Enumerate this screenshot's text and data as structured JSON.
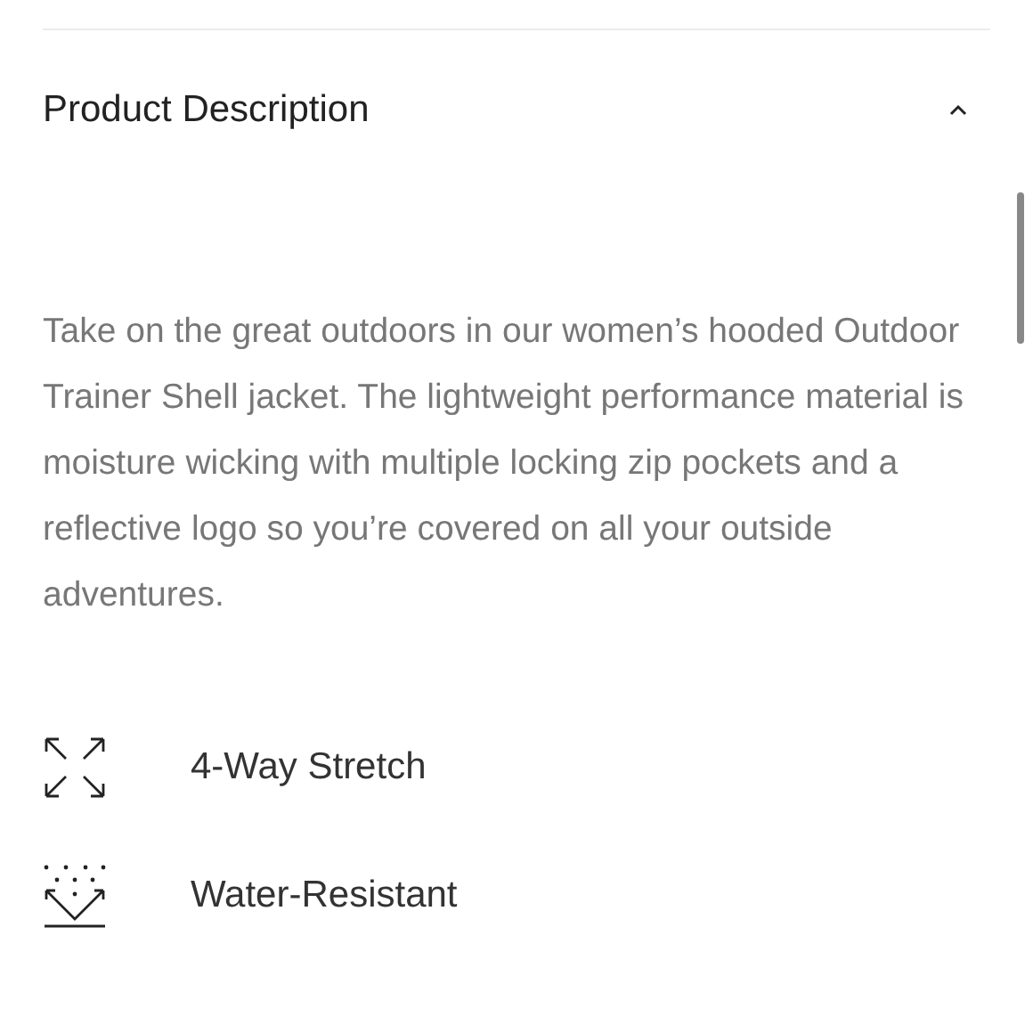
{
  "section": {
    "title": "Product Description",
    "expanded": true
  },
  "description": "Take on the great outdoors in our women’s hooded Outdoor Trainer Shell jacket. The lightweight performance material is moisture wicking with multiple locking zip pockets and a reflective logo so you’re covered on all your outside adventures.",
  "features": [
    {
      "kind": "stretch",
      "label": "4-Way Stretch"
    },
    {
      "kind": "water",
      "label": "Water-Resistant"
    }
  ]
}
